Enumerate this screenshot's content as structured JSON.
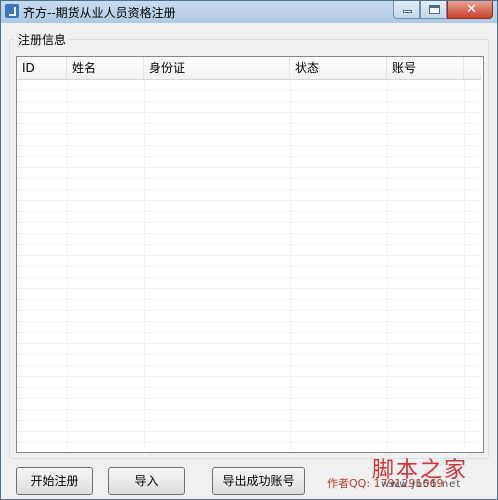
{
  "window": {
    "title": "齐方--期货从业人员资格注册"
  },
  "group": {
    "label": "注册信息"
  },
  "table": {
    "columns": [
      "ID",
      "姓名",
      "身份证",
      "状态",
      "账号"
    ],
    "rows": []
  },
  "buttons": {
    "start": "开始注册",
    "import": "导入",
    "export": "导出成功账号"
  },
  "watermark": {
    "author": "作者QQ: 1791291069",
    "site_logo": "脚本之家",
    "site_url": "www.jb51.net"
  }
}
